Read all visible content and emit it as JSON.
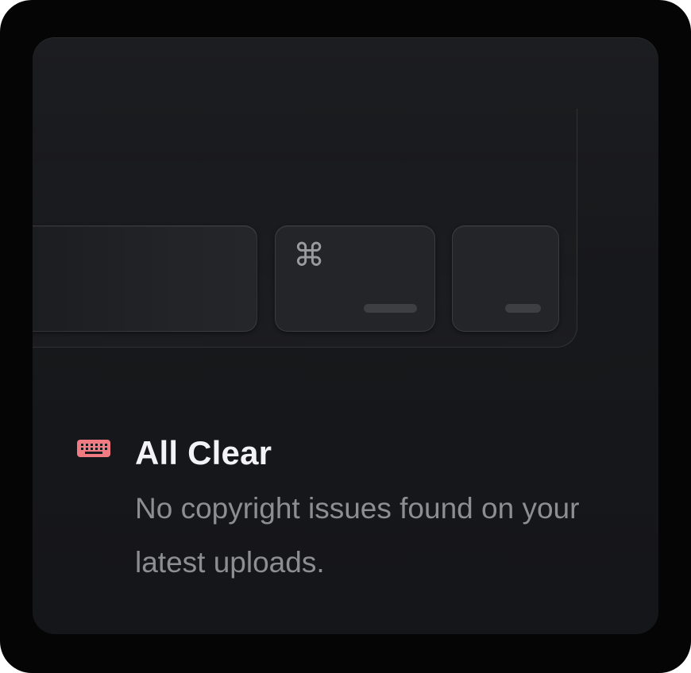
{
  "card": {
    "title": "All Clear",
    "description": "No copyright issues found on your latest uploads.",
    "accent_color": "#f07b83"
  },
  "keyboard": {
    "keys": [
      {
        "name": "wide-key",
        "glyph": ""
      },
      {
        "name": "command-key",
        "glyph": "⌘"
      },
      {
        "name": "small-key",
        "glyph": ""
      }
    ]
  },
  "icons": {
    "status_icon": "keyboard-icon",
    "command_icon": "command-icon"
  }
}
